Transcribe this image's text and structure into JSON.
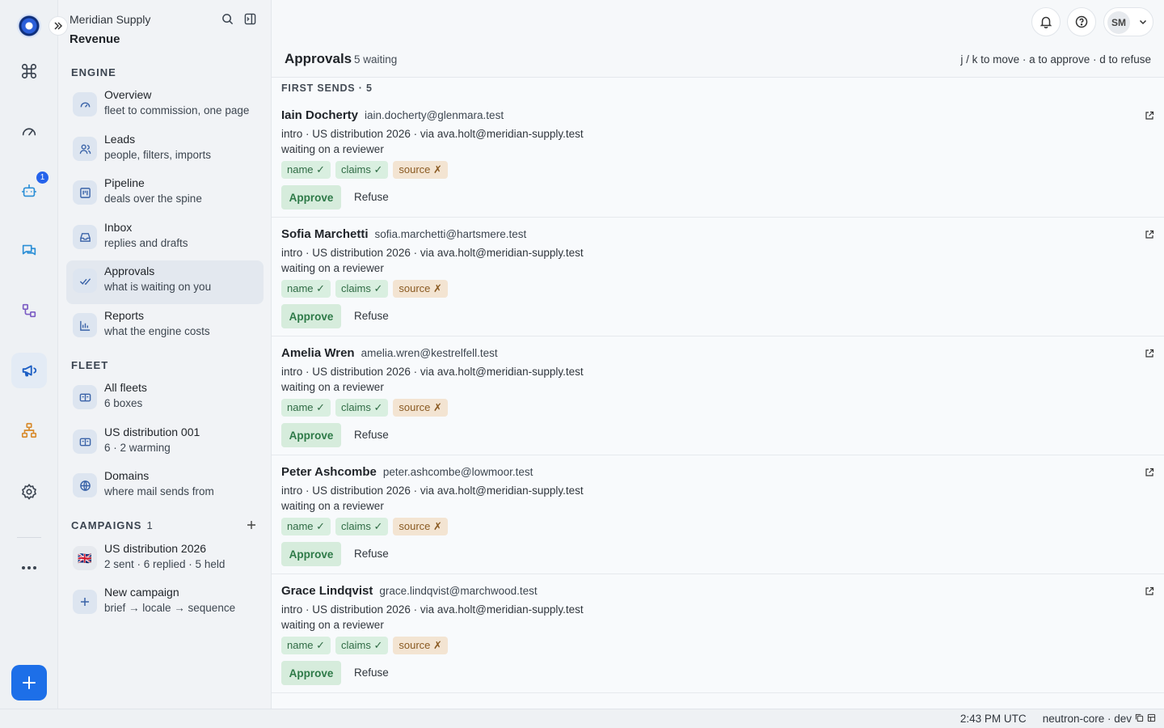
{
  "org": {
    "name": "Meridian Supply",
    "workspace": "Revenue"
  },
  "rail": {
    "badge": "1",
    "icons": [
      "command-icon",
      "gauge-icon",
      "bot-icon",
      "chat-icon",
      "workflow-icon",
      "megaphone-icon",
      "org-chart-icon",
      "gear-icon",
      "more-icon"
    ]
  },
  "sections": {
    "engine": "ENGINE",
    "fleet": "FLEET",
    "campaigns": "CAMPAIGNS",
    "campaigns_count": "1"
  },
  "nav": {
    "engine": [
      {
        "title": "Overview",
        "sub": "fleet to commission, one page"
      },
      {
        "title": "Leads",
        "sub": "people, filters, imports"
      },
      {
        "title": "Pipeline",
        "sub": "deals over the spine"
      },
      {
        "title": "Inbox",
        "sub": "replies and drafts"
      },
      {
        "title": "Approvals",
        "sub": "what is waiting on you"
      },
      {
        "title": "Reports",
        "sub": "what the engine costs"
      }
    ],
    "fleet": [
      {
        "title": "All fleets",
        "sub": "6 boxes"
      },
      {
        "title": "US distribution 001",
        "sub": "6 · 2 warming"
      },
      {
        "title": "Domains",
        "sub": "where mail sends from"
      }
    ],
    "campaigns": [
      {
        "title": "US distribution 2026",
        "sub": "2 sent · 6 replied · 5 held",
        "flag": "🇬🇧"
      },
      {
        "title": "New campaign",
        "sub": "brief → locale → sequence"
      }
    ]
  },
  "header": {
    "user_initials": "SM"
  },
  "main": {
    "title": "Approvals",
    "count": "5 waiting",
    "hint": "j / k to move · a to approve · d to refuse",
    "group": "FIRST SENDS · 5",
    "approve_label": "Approve",
    "refuse_label": "Refuse",
    "tags": {
      "name": "name ✓",
      "claims": "claims ✓",
      "source": "source ✗"
    },
    "items": [
      {
        "name": "Iain Docherty",
        "email": "iain.docherty@glenmara.test",
        "meta": "intro · US distribution 2026 · via ava.holt@meridian-supply.test",
        "status": "waiting on a reviewer"
      },
      {
        "name": "Sofia Marchetti",
        "email": "sofia.marchetti@hartsmere.test",
        "meta": "intro · US distribution 2026 · via ava.holt@meridian-supply.test",
        "status": "waiting on a reviewer"
      },
      {
        "name": "Amelia Wren",
        "email": "amelia.wren@kestrelfell.test",
        "meta": "intro · US distribution 2026 · via ava.holt@meridian-supply.test",
        "status": "waiting on a reviewer"
      },
      {
        "name": "Peter Ashcombe",
        "email": "peter.ashcombe@lowmoor.test",
        "meta": "intro · US distribution 2026 · via ava.holt@meridian-supply.test",
        "status": "waiting on a reviewer"
      },
      {
        "name": "Grace Lindqvist",
        "email": "grace.lindqvist@marchwood.test",
        "meta": "intro · US distribution 2026 · via ava.holt@meridian-supply.test",
        "status": "waiting on a reviewer"
      }
    ]
  },
  "statusbar": {
    "time": "2:43 PM UTC",
    "env": "neutron-core · dev"
  },
  "colors": {
    "accent": "#1d6fe8",
    "approve_bg": "#d6ecdc",
    "tag_ok": "#d9efe0",
    "tag_bad": "#f3e4d2"
  }
}
